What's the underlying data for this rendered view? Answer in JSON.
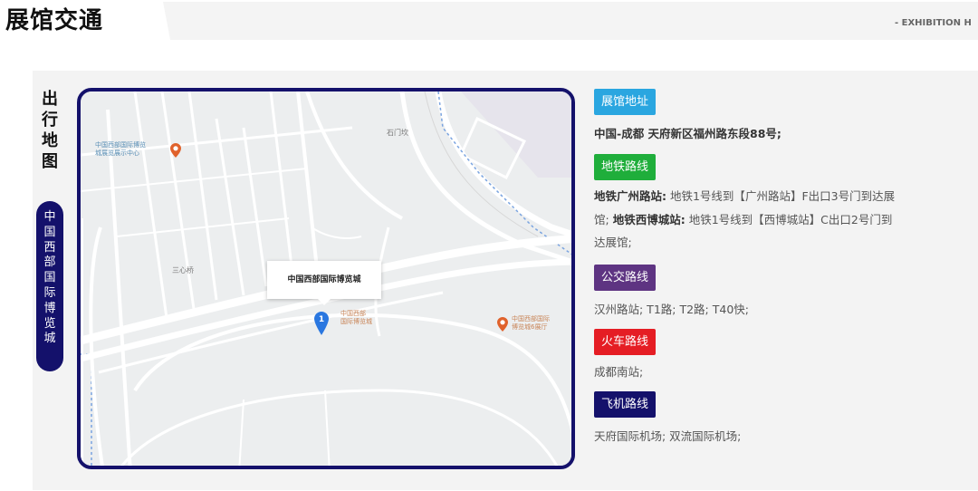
{
  "header": {
    "title": "展馆交通",
    "subtitle": "- EXHIBITION H"
  },
  "sidebar": {
    "title_chars": [
      "出",
      "行",
      "地",
      "图"
    ],
    "venue_chars": [
      "中",
      "国",
      "西",
      "部",
      "国",
      "际",
      "博",
      "览",
      "城"
    ]
  },
  "map": {
    "labels": {
      "shimenkan": "石门坎",
      "sanxinqiao": "三心桥",
      "showcenter_line1": "中国西部国际博览",
      "showcenter_line2": "城展览展示中心",
      "venue_line1": "中国西部",
      "venue_line2": "国际博览城",
      "hall6_line1": "中国西部国际",
      "hall6_line2": "博览城6展厅"
    },
    "callout": "中国西部国际博览城",
    "pin_number": "1"
  },
  "info": {
    "address": {
      "tag": "展馆地址",
      "tag_color": "#2aa6e0",
      "text": "中国-成都 天府新区福州路东段88号;"
    },
    "metro": {
      "tag": "地铁路线",
      "tag_color": "#1fae3b",
      "station1": "地铁广州路站:",
      "desc1": "地铁1号线到【广州路站】F出口3号门到达展",
      "desc1b": "馆;",
      "station2": "地铁西博城站:",
      "desc2": "地铁1号线到【西博城站】C出口2号门到",
      "desc2b": "达展馆;"
    },
    "bus": {
      "tag": "公交路线",
      "tag_color": "#5e3482",
      "text": "汉州路站; T1路; T2路; T40快;"
    },
    "train": {
      "tag": "火车路线",
      "tag_color": "#e51d24",
      "text": "成都南站;"
    },
    "plane": {
      "tag": "飞机路线",
      "tag_color": "#14116b",
      "text": "天府国际机场; 双流国际机场;"
    }
  },
  "colors": {
    "brand_navy": "#14116b",
    "panel_bg": "#f3f3f3"
  }
}
